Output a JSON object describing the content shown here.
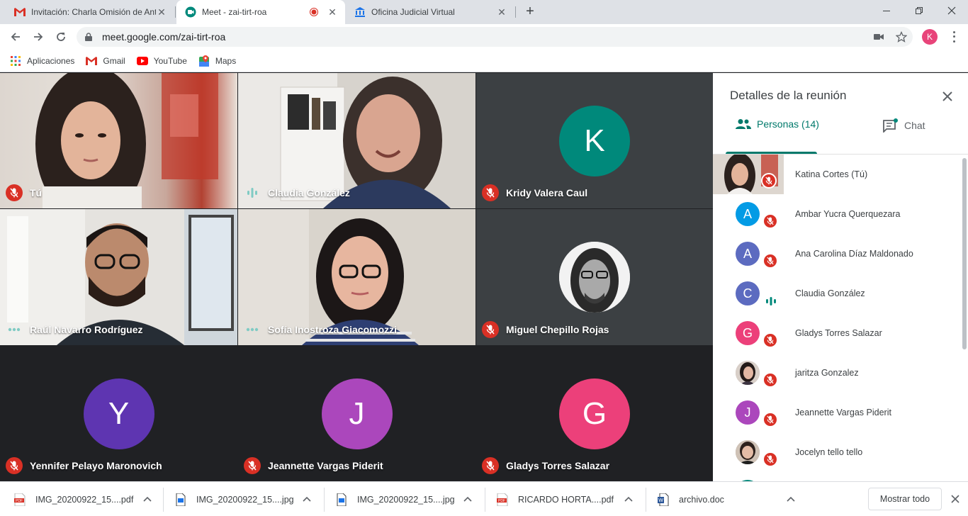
{
  "browser": {
    "tabs": [
      {
        "title": "Invitación: Charla Omisión de Ant",
        "icon": "gmail-icon"
      },
      {
        "title": "Meet - zai-tirt-roa",
        "icon": "meet-icon",
        "recording": true
      },
      {
        "title": "Oficina Judicial Virtual",
        "icon": "institution-icon"
      }
    ],
    "url": "meet.google.com/zai-tirt-roa",
    "profile_initial": "K",
    "bookmarks": [
      {
        "label": "Aplicaciones",
        "icon": "apps-grid-icon"
      },
      {
        "label": "Gmail",
        "icon": "gmail-icon"
      },
      {
        "label": "YouTube",
        "icon": "youtube-icon"
      },
      {
        "label": "Maps",
        "icon": "maps-icon"
      }
    ]
  },
  "meeting": {
    "tiles": [
      {
        "name": "Tú",
        "status": "muted",
        "type": "video"
      },
      {
        "name": "Claudia González",
        "status": "speaking",
        "type": "video"
      },
      {
        "name": "Kridy Valera Caul",
        "status": "muted",
        "type": "avatar",
        "initial": "K",
        "color": "#00897b"
      },
      {
        "name": "Raúl Navarro Rodríguez",
        "status": "dots",
        "type": "video"
      },
      {
        "name": "Sofía Inostroza Giacomozzi",
        "status": "dots",
        "type": "video"
      },
      {
        "name": "Miguel Chepillo Rojas",
        "status": "muted",
        "type": "photo"
      },
      {
        "name": "Yennifer Pelayo Maronovich",
        "status": "muted",
        "type": "avatar",
        "initial": "Y",
        "color": "#5e35b1"
      },
      {
        "name": "Jeannette Vargas Piderit",
        "status": "muted",
        "type": "avatar",
        "initial": "J",
        "color": "#ab47bc"
      },
      {
        "name": "Gladys Torres Salazar",
        "status": "muted",
        "type": "avatar",
        "initial": "G",
        "color": "#ec407a"
      }
    ]
  },
  "panel": {
    "title": "Detalles de la reunión",
    "tab_people": "Personas (14)",
    "tab_chat": "Chat",
    "people": [
      {
        "name": "Katina Cortes (Tú)",
        "type": "self",
        "status": "muted"
      },
      {
        "name": "Ambar Yucra Querquezara",
        "initial": "A",
        "color": "#039be5",
        "status": "muted"
      },
      {
        "name": "Ana Carolina Díaz Maldonado",
        "initial": "A",
        "color": "#5c6bc0",
        "status": "muted"
      },
      {
        "name": "Claudia González",
        "initial": "C",
        "color": "#5c6bc0",
        "status": "speaking"
      },
      {
        "name": "Gladys Torres Salazar",
        "initial": "G",
        "color": "#ec407a",
        "status": "muted"
      },
      {
        "name": "jaritza Gonzalez",
        "type": "photo",
        "status": "muted"
      },
      {
        "name": "Jeannette Vargas Piderit",
        "initial": "J",
        "color": "#ab47bc",
        "status": "muted"
      },
      {
        "name": "Jocelyn tello tello",
        "type": "photo",
        "status": "muted"
      }
    ]
  },
  "downloads": {
    "items": [
      {
        "name": "IMG_20200922_15....pdf",
        "type": "pdf"
      },
      {
        "name": "IMG_20200922_15....jpg",
        "type": "file"
      },
      {
        "name": "IMG_20200922_15....jpg",
        "type": "file"
      },
      {
        "name": "RICARDO HORTA....pdf",
        "type": "pdf"
      },
      {
        "name": "archivo.doc",
        "type": "doc"
      }
    ],
    "show_all": "Mostrar todo"
  }
}
